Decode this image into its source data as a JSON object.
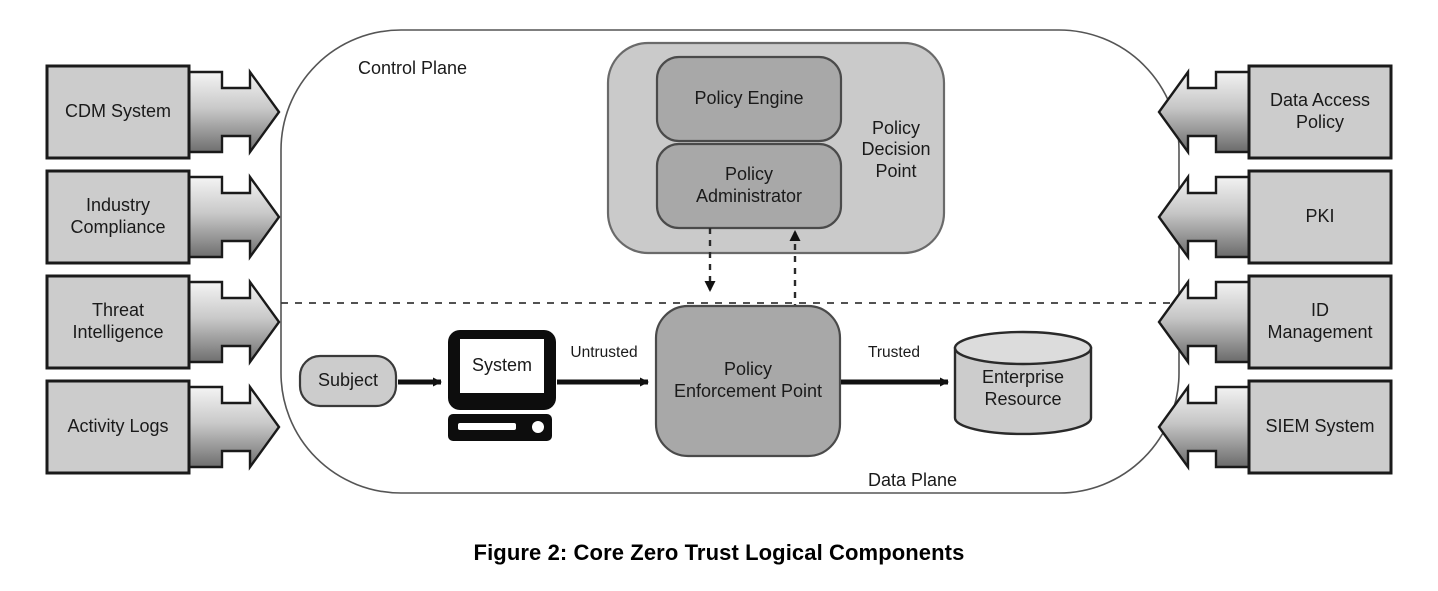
{
  "figure": {
    "caption": "Figure 2: Core Zero Trust Logical Components"
  },
  "planes": {
    "control_plane_label": "Control Plane",
    "data_plane_label": "Data Plane"
  },
  "left_inputs": [
    {
      "label": "CDM System",
      "arrow": "right-arrow-icon"
    },
    {
      "label": "Industry\nCompliance",
      "arrow": "right-arrow-icon"
    },
    {
      "label": "Threat\nIntelligence",
      "arrow": "right-arrow-icon"
    },
    {
      "label": "Activity Logs",
      "arrow": "right-arrow-icon"
    }
  ],
  "right_inputs": [
    {
      "label": "Data Access\nPolicy",
      "arrow": "left-arrow-icon"
    },
    {
      "label": "PKI",
      "arrow": "left-arrow-icon"
    },
    {
      "label": "ID\nManagement",
      "arrow": "left-arrow-icon"
    },
    {
      "label": "SIEM System",
      "arrow": "left-arrow-icon"
    }
  ],
  "policy_decision_point": {
    "label": "Policy\nDecision\nPoint",
    "components": [
      {
        "label": "Policy Engine"
      },
      {
        "label": "Policy\nAdministrator"
      }
    ]
  },
  "data_plane": {
    "subject": "Subject",
    "system": "System",
    "policy_enforcement_point": "Policy\nEnforcement Point",
    "enterprise_resource": "Enterprise\nResource",
    "flow_labels": {
      "untrusted": "Untrusted",
      "trusted": "Trusted"
    }
  },
  "colors": {
    "box_fill": "#cccccc",
    "pdp_outer_fill": "#cacaca",
    "pdp_inner_fill": "#a8a8a8",
    "pep_fill": "#a8a8a8",
    "resource_fill": "#cccccc",
    "stroke": "#1a1a1a",
    "plane_outline": "#555555",
    "background": "#ffffff"
  }
}
